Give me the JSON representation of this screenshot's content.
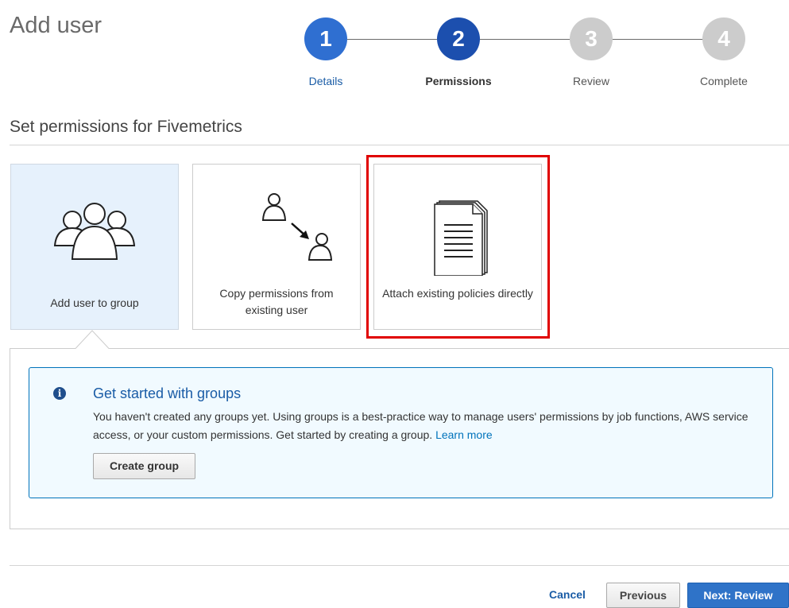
{
  "page_title": "Add user",
  "steps": [
    {
      "number": "1",
      "label": "Details",
      "state": "completed"
    },
    {
      "number": "2",
      "label": "Permissions",
      "state": "current"
    },
    {
      "number": "3",
      "label": "Review",
      "state": "upcoming"
    },
    {
      "number": "4",
      "label": "Complete",
      "state": "upcoming"
    }
  ],
  "section_title": "Set permissions for Fivemetrics",
  "options": [
    {
      "label": "Add user to group",
      "icon": "users-group-icon",
      "selected": true
    },
    {
      "label": "Copy permissions from existing user",
      "icon": "copy-user-icon",
      "selected": false
    },
    {
      "label": "Attach existing policies directly",
      "icon": "policy-document-icon",
      "selected": false
    }
  ],
  "info": {
    "title": "Get started with groups",
    "text": "You haven't created any groups yet. Using groups is a best-practice way to manage users' permissions by job functions, AWS service access, or your custom permissions. Get started by creating a group.",
    "link": "Learn more",
    "button": "Create group"
  },
  "footer": {
    "cancel": "Cancel",
    "previous": "Previous",
    "next": "Next: Review"
  },
  "colors": {
    "step_completed": "#2f6fd1",
    "step_current": "#1c4fae",
    "step_upcoming": "#cccccc",
    "highlight": "#e00000",
    "primary_button": "#2f73c8"
  }
}
